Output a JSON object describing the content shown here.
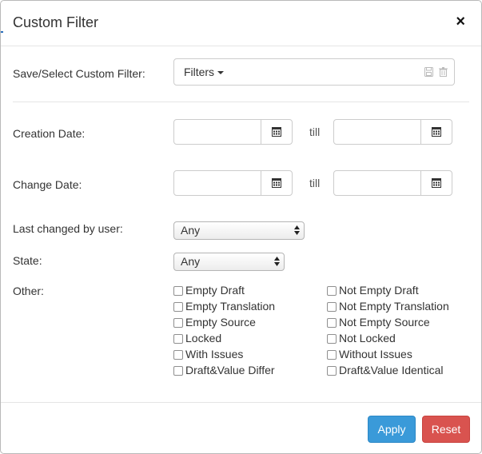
{
  "dialog": {
    "title": "Custom Filter",
    "close_label": "×"
  },
  "fields": {
    "custom_filter_label": "Save/Select Custom Filter:",
    "filters_button": "Filters",
    "custom_filter_value": "",
    "creation_date_label": "Creation Date:",
    "change_date_label": "Change Date:",
    "till": "till",
    "last_changed_label": "Last changed by user:",
    "last_changed_value": "Any",
    "state_label": "State:",
    "state_value": "Any",
    "other_label": "Other:"
  },
  "checkboxes": {
    "left": [
      "Empty Draft",
      "Empty Translation",
      "Empty Source",
      "Locked",
      "With Issues",
      "Draft&Value Differ"
    ],
    "right": [
      "Not Empty Draft",
      "Not Empty Translation",
      "Not Empty Source",
      "Not Locked",
      "Without Issues",
      "Draft&Value Identical"
    ]
  },
  "footer": {
    "apply_label": "Apply",
    "reset_label": "Reset"
  },
  "colors": {
    "apply": "#3a9ad9",
    "reset": "#d9534f"
  },
  "icons": [
    "save-icon",
    "trash-icon",
    "calendar-icon",
    "caret-down-icon",
    "select-arrows-icon",
    "close-icon"
  ]
}
